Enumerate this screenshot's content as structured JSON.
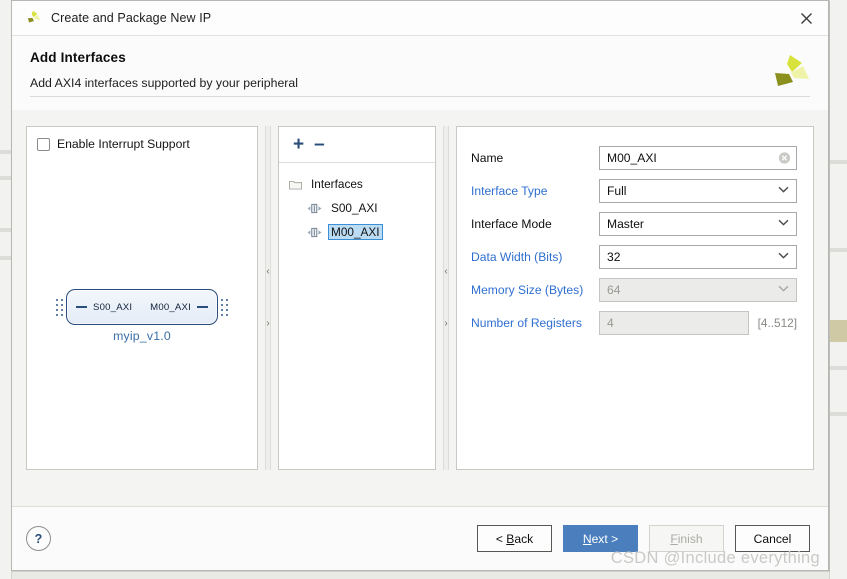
{
  "window": {
    "title": "Create and Package New IP",
    "app_icon": "xilinx-logo-icon",
    "close_icon": "close-icon"
  },
  "header": {
    "title": "Add Interfaces",
    "subtitle": "Add AXI4 interfaces supported by your peripheral",
    "brand_icon": "xilinx-logo-icon"
  },
  "left_panel": {
    "interrupt_checkbox_label": "Enable Interrupt Support",
    "interrupt_checked": false,
    "diagram": {
      "left_port": "S00_AXI",
      "right_port": "M00_AXI",
      "caption": "myip_v1.0"
    }
  },
  "middle_panel": {
    "toolbar": {
      "add_label": "+",
      "remove_label": "–",
      "add_icon": "plus-icon",
      "remove_icon": "minus-icon"
    },
    "tree": {
      "root_label": "Interfaces",
      "root_icon": "folder-icon",
      "items": [
        {
          "label": "S00_AXI",
          "icon": "bus-interface-icon",
          "selected": false
        },
        {
          "label": "M00_AXI",
          "icon": "bus-interface-icon",
          "selected": true
        }
      ]
    }
  },
  "splitters": {
    "collapse_left_icon": "chevron-left-icon",
    "collapse_right_icon": "chevron-right-icon",
    "collapse_left_glyph": "‹",
    "collapse_right_glyph": "›"
  },
  "right_panel": {
    "fields": [
      {
        "label": "Name",
        "value": "M00_AXI",
        "type": "text",
        "disabled": false,
        "link": false,
        "suffix": ""
      },
      {
        "label": "Interface Type",
        "value": "Full",
        "type": "combo",
        "disabled": false,
        "link": true,
        "suffix": ""
      },
      {
        "label": "Interface Mode",
        "value": "Master",
        "type": "combo",
        "disabled": false,
        "link": false,
        "suffix": ""
      },
      {
        "label": "Data Width (Bits)",
        "value": "32",
        "type": "combo",
        "disabled": false,
        "link": true,
        "suffix": ""
      },
      {
        "label": "Memory Size (Bytes)",
        "value": "64",
        "type": "combo",
        "disabled": true,
        "link": true,
        "suffix": ""
      },
      {
        "label": "Number of Registers",
        "value": "4",
        "type": "text",
        "disabled": true,
        "link": true,
        "suffix": "[4..512]"
      }
    ],
    "clear_icon": "clear-circle-x-icon"
  },
  "footer": {
    "help_label": "?",
    "help_icon": "help-question-icon",
    "back_label": "< Back",
    "back_accel": "B",
    "next_label": "Next >",
    "next_accel": "N",
    "finish_label": "Finish",
    "finish_accel": "F",
    "finish_disabled": true,
    "cancel_label": "Cancel"
  },
  "watermark": {
    "text": "CSDN @Include everything"
  },
  "colors": {
    "primary_button": "#4a7ebd",
    "link_label": "#2f6fd0",
    "diagram_outline": "#2a4d7a",
    "diagram_caption": "#3a6ea5",
    "tree_selection": "#bcdcf4",
    "brand_green": "#c3d02a"
  }
}
